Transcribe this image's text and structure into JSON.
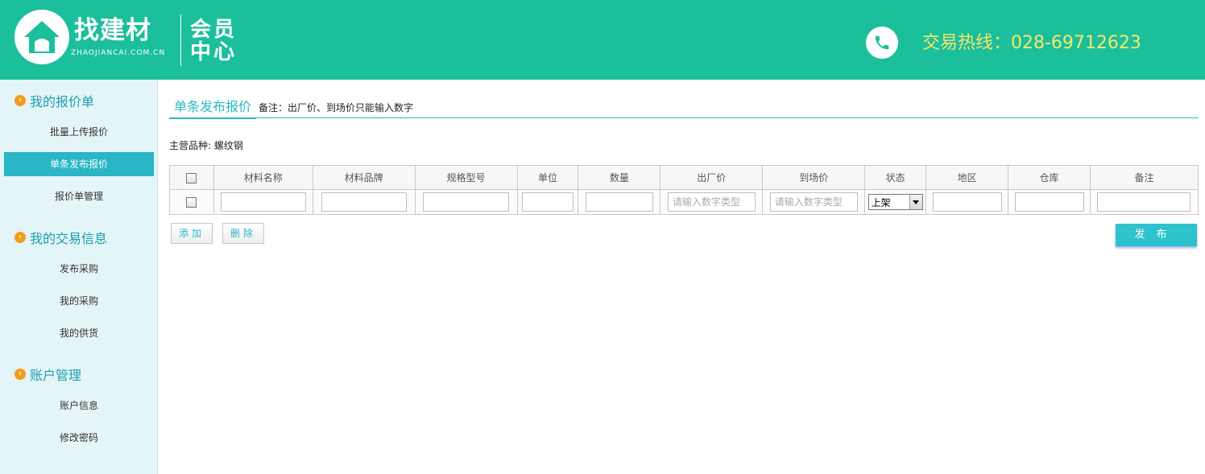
{
  "header": {
    "logo_text": "找建材",
    "logo_domain": "ZHAOJIANCAI.COM.CN",
    "member_line1": "会员",
    "member_line2": "中心",
    "hotline": "交易热线：028-69712623"
  },
  "sidebar": {
    "groups": [
      {
        "label": "我的报价单",
        "items": [
          "批量上传报价",
          "单条发布报价",
          "报价单管理"
        ]
      },
      {
        "label": "我的交易信息",
        "items": [
          "发布采购",
          "我的采购",
          "我的供货"
        ]
      },
      {
        "label": "账户管理",
        "items": [
          "账户信息",
          "修改密码"
        ]
      }
    ],
    "active_item": "单条发布报价"
  },
  "main": {
    "tab_title": "单条发布报价",
    "tab_note": "备注：出厂价、到场价只能输入数字",
    "variety_label": "主营品种:",
    "variety_value": "螺纹钢",
    "table": {
      "headers": [
        "材料名称",
        "材料品牌",
        "规格型号",
        "单位",
        "数量",
        "出厂价",
        "到场价",
        "状态",
        "地区",
        "仓库",
        "备注"
      ],
      "price_placeholder": "请输入数字类型",
      "status_selected": "上架"
    },
    "add_button": "添加",
    "delete_button": "删除",
    "publish_button": "发布"
  },
  "colors": {
    "header_bg": "#1bbf9b",
    "accent": "#2ab6c4",
    "hotline": "#f5e86a",
    "sidebar_bg": "#e4f5f7",
    "bullet": "#f39c1b"
  }
}
